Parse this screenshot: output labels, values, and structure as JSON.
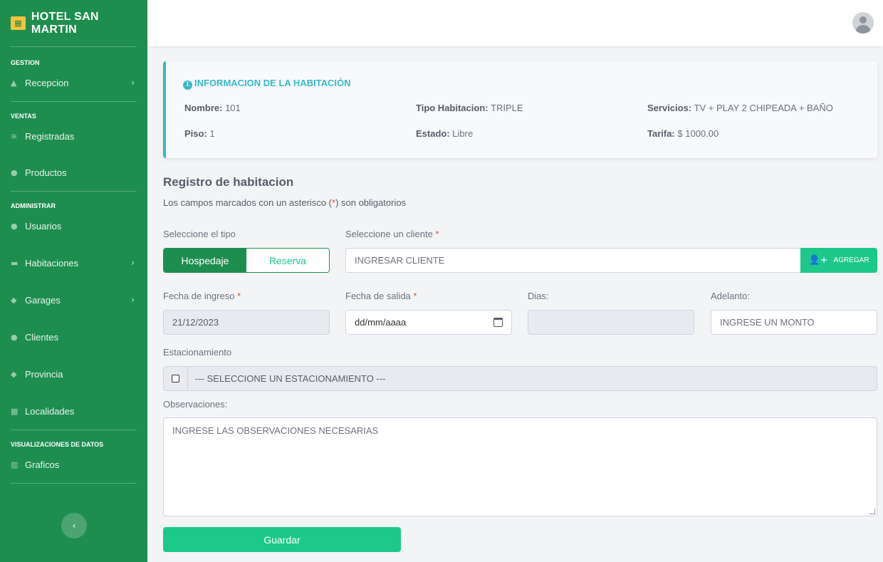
{
  "sidebar": {
    "brand": "HOTEL SAN MARTIN",
    "sections": {
      "gestion": "GESTION",
      "ventas": "VENTAS",
      "administrar": "ADMINISTRAR",
      "visualizaciones": "VISUALIZACIONES DE DATOS"
    },
    "items": {
      "recepcion": "Recepcion",
      "registradas": "Registradas",
      "productos": "Productos",
      "usuarios": "Usuarios",
      "habitaciones": "Habitaciones",
      "garages": "Garages",
      "clientes": "Clientes",
      "provincia": "Provincia",
      "localidades": "Localidades",
      "graficos": "Graficos"
    }
  },
  "info": {
    "title": "INFORMACION DE LA HABITACIÓN",
    "nombre_label": "Nombre:",
    "nombre": "101",
    "tipo_label": "Tipo Habitacion:",
    "tipo": "TRIPLE",
    "servicios_label": "Servicios:",
    "servicios": "TV + PLAY 2 CHIPEADA + BAÑO",
    "piso_label": "Piso:",
    "piso": "1",
    "estado_label": "Estado:",
    "estado": "Libre",
    "tarifa_label": "Tarifa:",
    "tarifa": "$ 1000.00"
  },
  "form": {
    "title": "Registro de habitacion",
    "subtitle_pre": "Los campos marcados con un asterisco (",
    "subtitle_star": "*",
    "subtitle_post": ") son obligatorios",
    "tipo_label": "Seleccione el tipo",
    "tipo_options": [
      "Hospedaje",
      "Reserva"
    ],
    "cliente_label": "Seleccione un cliente",
    "cliente_placeholder": "INGRESAR CLIENTE",
    "agregar_label": "AGREGAR",
    "ingreso_label": "Fecha de ingreso",
    "ingreso_value": "21/12/2023",
    "salida_label": "Fecha de salida",
    "salida_value": "dd/mm/aaaa",
    "dias_label": "Dias:",
    "dias_value": "",
    "adelanto_label": "Adelanto:",
    "adelanto_placeholder": "INGRESE UN MONTO",
    "estacionamiento_label": "Estacionamiento",
    "estacionamiento_placeholder": "--- SELECCIONE UN ESTACIONAMIENTO ---",
    "observaciones_label": "Observaciones:",
    "observaciones_placeholder": "INGRESE LAS OBSERVACIONES NECESARIAS",
    "required_mark": "*",
    "save_label": "Guardar"
  },
  "colors": {
    "sidebar": "#1e8e4f",
    "accent": "#1cc88a",
    "info": "#36b9cc",
    "required": "#e74a3b"
  },
  "icons": {
    "brand": "hotel-icon",
    "recepcion": "bell-icon",
    "registradas": "list-icon",
    "productos": "box-icon",
    "usuarios": "user-icon",
    "habitaciones": "bed-icon",
    "garages": "car-icon",
    "clientes": "users-icon",
    "provincia": "map-icon",
    "localidades": "building-icon",
    "graficos": "chart-icon"
  }
}
